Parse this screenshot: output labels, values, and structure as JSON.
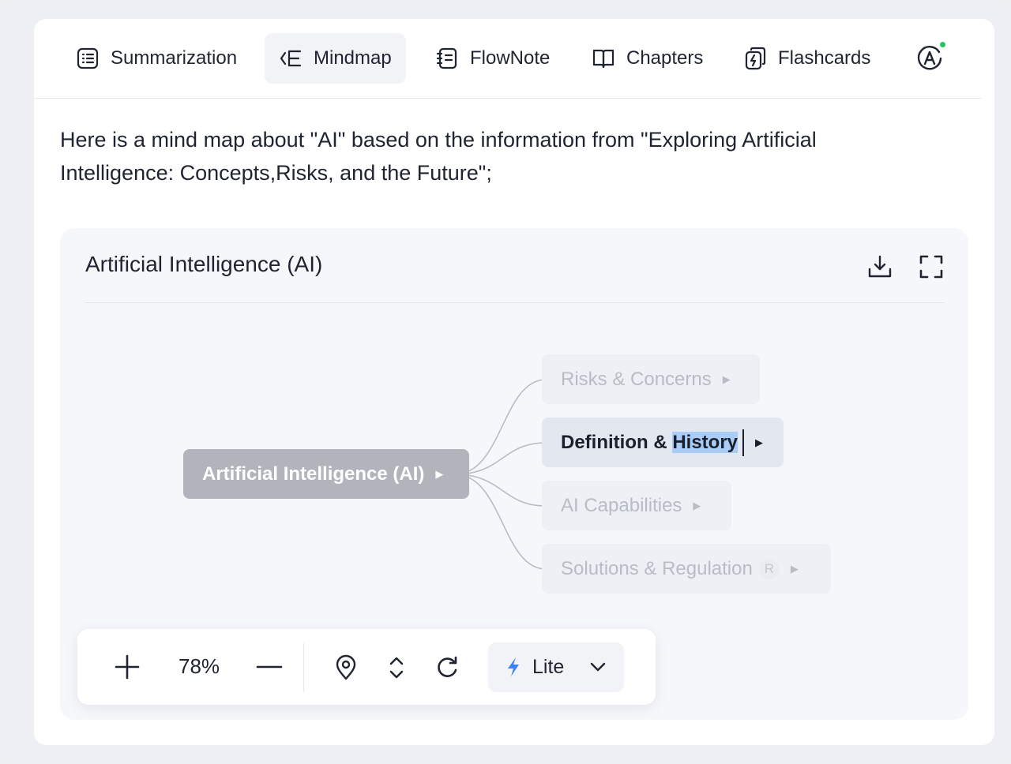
{
  "tabs": [
    {
      "label": "Summarization",
      "icon": "summary-list-icon",
      "active": false
    },
    {
      "label": "Mindmap",
      "icon": "mindmap-icon",
      "active": true
    },
    {
      "label": "FlowNote",
      "icon": "flownote-icon",
      "active": false
    },
    {
      "label": "Chapters",
      "icon": "book-icon",
      "active": false
    },
    {
      "label": "Flashcards",
      "icon": "flashcards-icon",
      "active": false
    }
  ],
  "account": {
    "icon": "account-a-icon",
    "status_color": "#22c55e"
  },
  "intro": {
    "line1": "Here is a mind map about \"AI\" based on the information from \"Exploring Artificial",
    "line2": "Intelligence: Concepts,Risks, and the Future\";"
  },
  "panel": {
    "title": "Artificial Intelligence (AI)",
    "download_icon": "download-icon",
    "fullscreen_icon": "fullscreen-icon"
  },
  "mindmap": {
    "root": "Artificial Intelligence (AI)",
    "children": [
      {
        "label": "Risks & Concerns"
      },
      {
        "label_plain": "Definition & ",
        "label_highlight": "History"
      },
      {
        "label": "AI Capabilities"
      },
      {
        "label": "Solutions & Regulation",
        "badge": "R"
      }
    ]
  },
  "toolbar": {
    "zoom": "78%",
    "mode_label": "Lite",
    "colors": {
      "bolt": "#3b82f6"
    }
  },
  "colors": {
    "root_node": "#b1b4bb",
    "selected_node": "#e3e8f0",
    "highlight": "#a9cdf7",
    "panel_bg": "#f5f7fb"
  }
}
